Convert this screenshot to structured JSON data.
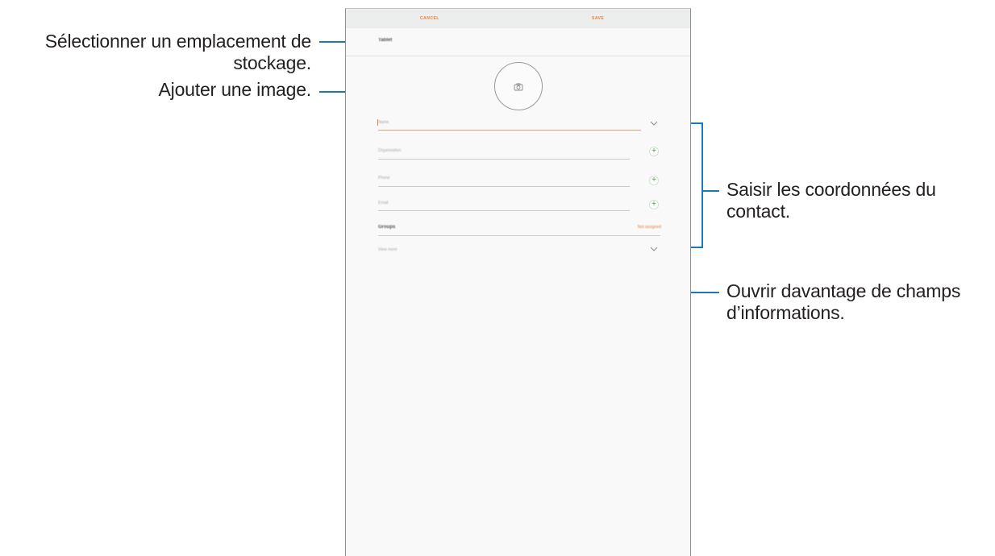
{
  "annotations": {
    "storage": [
      "Sélectionner un emplacement de",
      "stockage."
    ],
    "image": "Ajouter une image.",
    "contact_info": [
      "Saisir les coordonnées du",
      "contact."
    ],
    "more_fields": [
      "Ouvrir davantage de champs",
      "d’informations."
    ]
  },
  "screen": {
    "topbar": {
      "cancel_label": "CANCEL",
      "save_label": "SAVE"
    },
    "storage_location": "Tablet",
    "fields": {
      "name_placeholder": "Name",
      "organization_placeholder": "Organisation",
      "phone_placeholder": "Phone",
      "email_placeholder": "Email"
    },
    "groups": {
      "label": "Groups",
      "value": "Not assigned"
    },
    "view_more_label": "View more"
  },
  "colors": {
    "accent": "#e97d3a",
    "leader_line": "#1a79b4",
    "add_icon": "#4aa24a"
  }
}
